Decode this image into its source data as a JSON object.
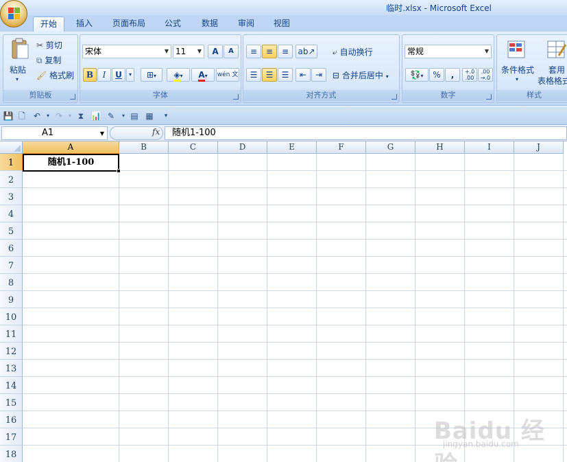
{
  "window": {
    "title": "临时.xlsx - Microsoft Excel"
  },
  "tabs": [
    {
      "label": "开始",
      "active": true
    },
    {
      "label": "插入"
    },
    {
      "label": "页面布局"
    },
    {
      "label": "公式"
    },
    {
      "label": "数据"
    },
    {
      "label": "审阅"
    },
    {
      "label": "视图"
    }
  ],
  "ribbon": {
    "clipboard": {
      "paste": "粘贴",
      "cut": "剪切",
      "copy": "复制",
      "format_painter": "格式刷",
      "label": "剪贴板"
    },
    "font": {
      "name": "宋体",
      "size": "11",
      "bold": "B",
      "italic": "I",
      "underline": "U",
      "label": "字体",
      "grow": "A",
      "shrink": "A",
      "color": "A",
      "wen": "wén 文"
    },
    "alignment": {
      "wrap": "自动换行",
      "merge": "合并后居中",
      "label": "对齐方式"
    },
    "number": {
      "format": "常规",
      "percent": "%",
      "comma": ",",
      "inc_decimal": "+.0 .00",
      "dec_decimal": ".00 →.0",
      "label": "数字"
    },
    "styles": {
      "conditional": "条件格式",
      "table": "套用",
      "table2": "表格格式",
      "label": "样式"
    }
  },
  "formula_bar": {
    "name_box": "A1",
    "fx": "fx",
    "content": "随机1-100"
  },
  "grid": {
    "columns": [
      "A",
      "B",
      "C",
      "D",
      "E",
      "F",
      "G",
      "H",
      "I",
      "J"
    ],
    "rows": [
      "1",
      "2",
      "3",
      "4",
      "5",
      "6",
      "7",
      "8",
      "9",
      "10",
      "11",
      "12",
      "13",
      "14",
      "15",
      "16",
      "17",
      "18"
    ],
    "selected_cell": "A1",
    "cells": {
      "A1": "随机1-100"
    }
  },
  "watermark": {
    "text": "Baidu 经验",
    "sub": "jingyan.baidu.com"
  },
  "colors": {
    "accent": "#15428b",
    "selection": "#f1c15f",
    "ribbon": "#d4e4f8"
  }
}
